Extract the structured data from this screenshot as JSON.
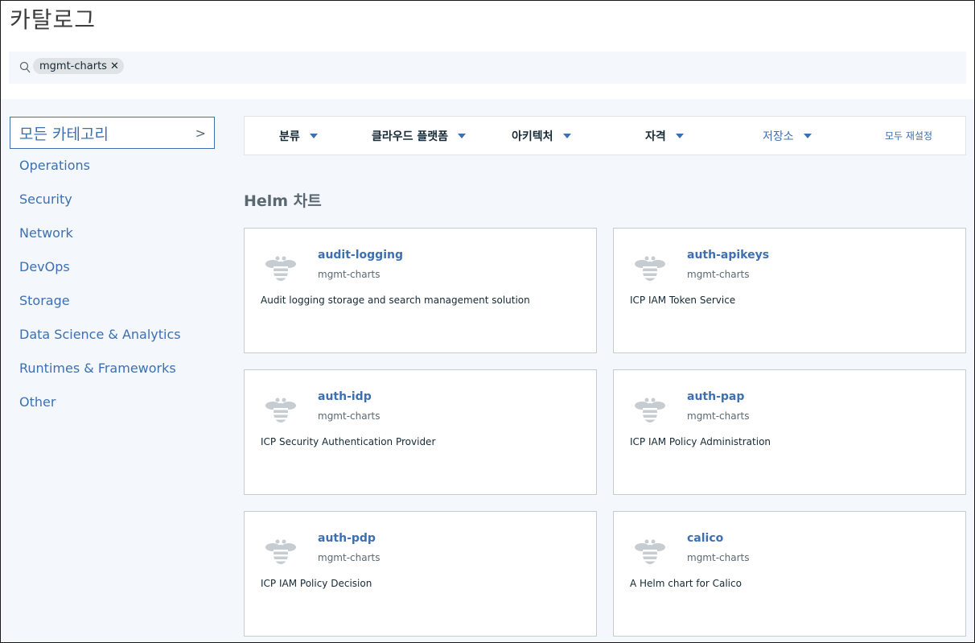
{
  "header": {
    "title": "카탈로그",
    "search": {
      "chip_label": "mgmt-charts",
      "chip_close": "✕"
    }
  },
  "sidebar": {
    "all_label": "모든 카테고리",
    "all_chevron": ">",
    "items": [
      {
        "label": "Operations"
      },
      {
        "label": "Security"
      },
      {
        "label": "Network"
      },
      {
        "label": "DevOps"
      },
      {
        "label": "Storage"
      },
      {
        "label": "Data Science & Analytics"
      },
      {
        "label": "Runtimes & Frameworks"
      },
      {
        "label": "Other"
      }
    ]
  },
  "filters": {
    "items": [
      {
        "label": "분류"
      },
      {
        "label": "클라우드 플랫폼"
      },
      {
        "label": "아키텍처"
      },
      {
        "label": "자격"
      },
      {
        "label": "저장소"
      }
    ],
    "reset_label": "모두 재설정"
  },
  "section": {
    "title": "Helm 차트"
  },
  "cards": [
    {
      "name": "audit-logging",
      "repo": "mgmt-charts",
      "description": "Audit logging storage and search management solution",
      "icon": "bee-icon"
    },
    {
      "name": "auth-apikeys",
      "repo": "mgmt-charts",
      "description": "ICP IAM Token Service",
      "icon": "bee-icon"
    },
    {
      "name": "auth-idp",
      "repo": "mgmt-charts",
      "description": "ICP Security Authentication Provider",
      "icon": "bee-icon"
    },
    {
      "name": "auth-pap",
      "repo": "mgmt-charts",
      "description": "ICP IAM Policy Administration",
      "icon": "bee-icon"
    },
    {
      "name": "auth-pdp",
      "repo": "mgmt-charts",
      "description": "ICP IAM Policy Decision",
      "icon": "bee-icon"
    },
    {
      "name": "calico",
      "repo": "mgmt-charts",
      "description": "A Helm chart for Calico",
      "icon": "bee-icon"
    }
  ],
  "colors": {
    "accent": "#3d70b2",
    "background": "#f4f7fb",
    "text": "#152935"
  }
}
